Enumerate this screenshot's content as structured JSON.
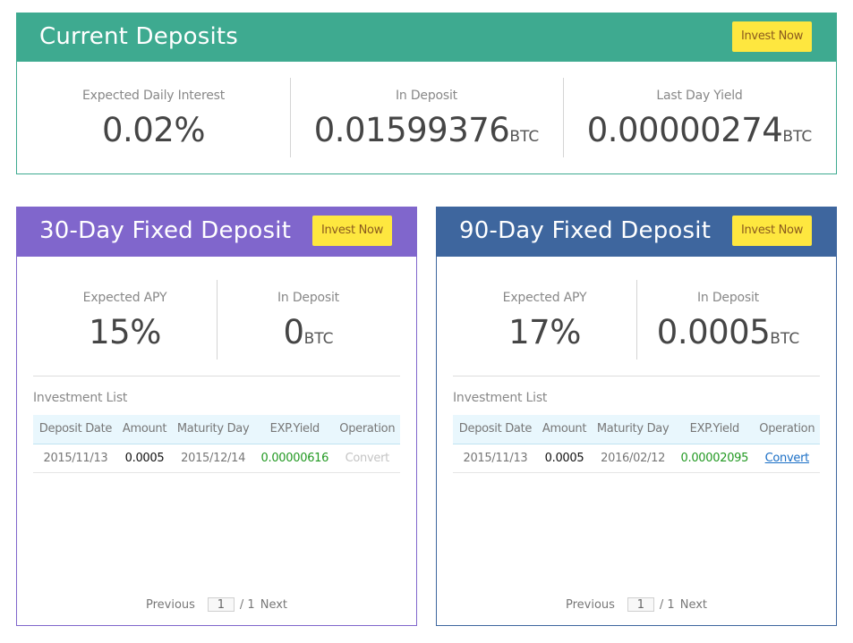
{
  "colors": {
    "current_accent": "#3eaa90",
    "fixed30_accent": "#8066cc",
    "fixed90_accent": "#3e669e",
    "invest_button_bg": "#fee73f",
    "yield_green": "#229922",
    "link_blue": "#1b6fc6"
  },
  "current": {
    "title": "Current Deposits",
    "invest_label": "Invest Now",
    "stats": [
      {
        "label": "Expected Daily Interest",
        "value": "0.02%",
        "unit": ""
      },
      {
        "label": "In Deposit",
        "value": "0.01599376",
        "unit": "BTC"
      },
      {
        "label": "Last Day Yield",
        "value": "0.00000274",
        "unit": "BTC"
      }
    ]
  },
  "fixed30": {
    "title": "30-Day Fixed Deposit",
    "invest_label": "Invest Now",
    "stats": [
      {
        "label": "Expected APY",
        "value": "15%",
        "unit": ""
      },
      {
        "label": "In Deposit",
        "value": "0",
        "unit": "BTC"
      }
    ],
    "list_title": "Investment List",
    "columns": [
      "Deposit Date",
      "Amount",
      "Maturity Day",
      "EXP.Yield",
      "Operation"
    ],
    "rows": [
      {
        "deposit_date": "2015/11/13",
        "amount": "0.0005",
        "maturity_day": "2015/12/14",
        "exp_yield": "0.00000616",
        "operation": "Convert",
        "operation_enabled": false
      }
    ],
    "pager": {
      "previous": "Previous",
      "page": "1",
      "total": "/ 1",
      "next": "Next"
    }
  },
  "fixed90": {
    "title": "90-Day Fixed Deposit",
    "invest_label": "Invest Now",
    "stats": [
      {
        "label": "Expected APY",
        "value": "17%",
        "unit": ""
      },
      {
        "label": "In Deposit",
        "value": "0.0005",
        "unit": "BTC"
      }
    ],
    "list_title": "Investment List",
    "columns": [
      "Deposit Date",
      "Amount",
      "Maturity Day",
      "EXP.Yield",
      "Operation"
    ],
    "rows": [
      {
        "deposit_date": "2015/11/13",
        "amount": "0.0005",
        "maturity_day": "2016/02/12",
        "exp_yield": "0.00002095",
        "operation": "Convert",
        "operation_enabled": true
      }
    ],
    "pager": {
      "previous": "Previous",
      "page": "1",
      "total": "/ 1",
      "next": "Next"
    }
  }
}
